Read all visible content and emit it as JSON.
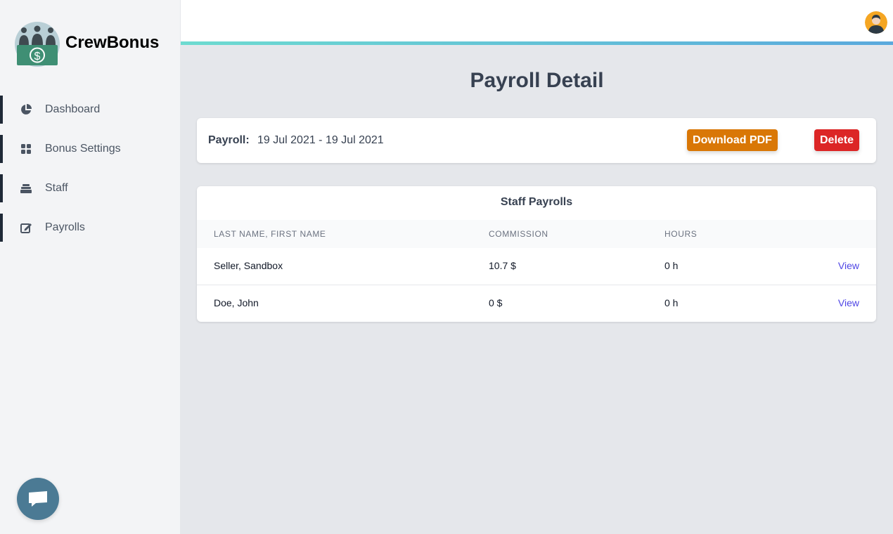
{
  "brand": {
    "name": "CrewBonus"
  },
  "nav": [
    {
      "label": "Dashboard",
      "icon": "pie-chart-icon"
    },
    {
      "label": "Bonus Settings",
      "icon": "grid-icon"
    },
    {
      "label": "Staff",
      "icon": "layers-icon"
    },
    {
      "label": "Payrolls",
      "icon": "edit-icon"
    }
  ],
  "page": {
    "title": "Payroll Detail"
  },
  "payroll": {
    "label": "Payroll:",
    "range": "19 Jul 2021 - 19 Jul 2021",
    "download_label": "Download PDF",
    "delete_label": "Delete"
  },
  "staff_payrolls": {
    "title": "Staff Payrolls",
    "columns": [
      "LAST NAME, FIRST NAME",
      "COMMISSION",
      "HOURS"
    ],
    "rows": [
      {
        "name": "Seller, Sandbox",
        "commission": "10.7 $",
        "hours": "0 h",
        "action": "View"
      },
      {
        "name": "Doe, John",
        "commission": "0 $",
        "hours": "0 h",
        "action": "View"
      }
    ]
  },
  "colors": {
    "accent_start": "#6ddbd0",
    "accent_end": "#5aa9dd",
    "pdf_button": "#d97706",
    "delete_button": "#dc2626",
    "link": "#4f46e5",
    "chat": "#4b7a94"
  }
}
